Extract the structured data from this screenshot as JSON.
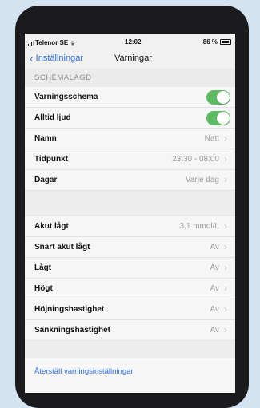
{
  "status_bar": {
    "carrier": "Telenor SE",
    "time": "12:02",
    "battery": "86 %"
  },
  "nav": {
    "back_label": "Inställningar",
    "title": "Varningar"
  },
  "schedule_section": {
    "header": "SCHEMALAGD",
    "rows": [
      {
        "label": "Varningsschema",
        "toggle": true
      },
      {
        "label": "Alltid ljud",
        "toggle": true
      },
      {
        "label": "Namn",
        "value": "Natt"
      },
      {
        "label": "Tidpunkt",
        "value": "23:30 - 08:00"
      },
      {
        "label": "Dagar",
        "value": "Varje dag"
      }
    ]
  },
  "alerts_section": {
    "rows": [
      {
        "label": "Akut lågt",
        "value": "3,1 mmol/L"
      },
      {
        "label": "Snart akut lågt",
        "value": "Av"
      },
      {
        "label": "Lågt",
        "value": "Av"
      },
      {
        "label": "Högt",
        "value": "Av"
      },
      {
        "label": "Höjningshastighet",
        "value": "Av"
      },
      {
        "label": "Sänkningshastighet",
        "value": "Av"
      }
    ]
  },
  "reset_link": "Återställ varningsinställningar",
  "colors": {
    "accent": "#2e6ee6",
    "toggle_on": "#5dbb63",
    "background": "#d3e3f1"
  }
}
